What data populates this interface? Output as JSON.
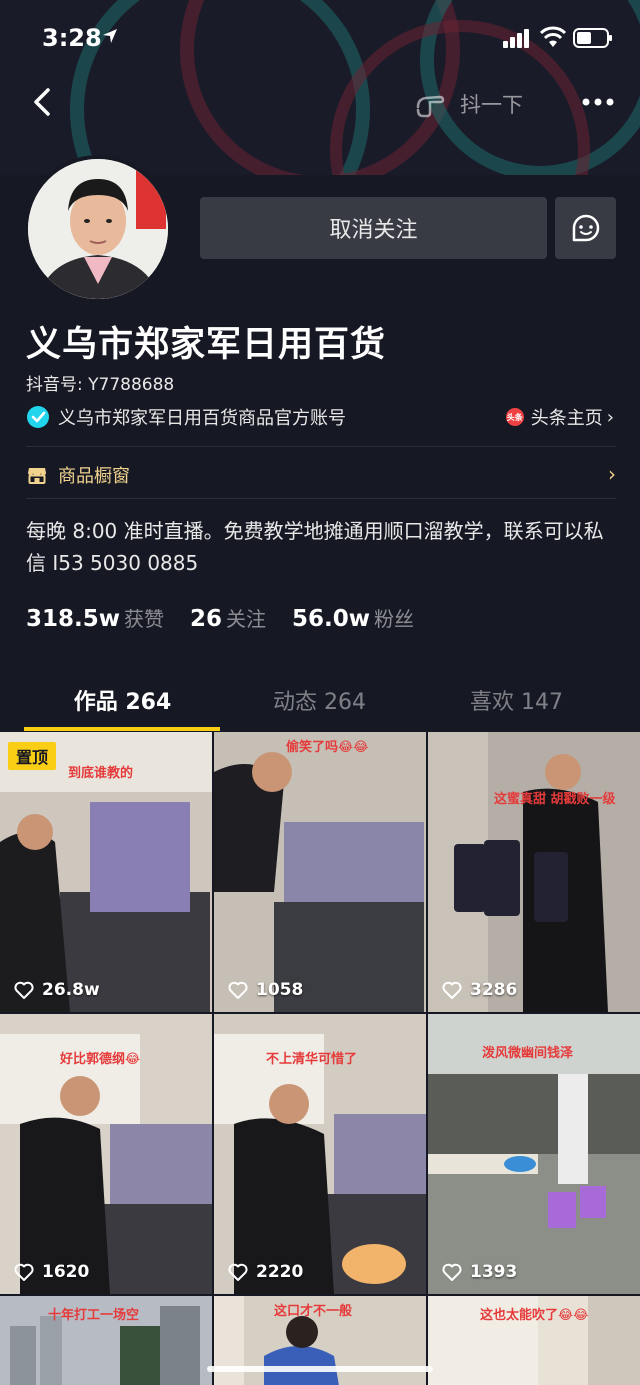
{
  "status_bar": {
    "time": "3:28"
  },
  "nav": {
    "shake_label": "抖一下"
  },
  "profile": {
    "unfollow_label": "取消关注",
    "name": "义乌市郑家军日用百货",
    "douyin_id": "抖音号: Y7788688",
    "verified_text": "义乌市郑家军日用百货商品官方账号",
    "toutiao_badge": "头条",
    "toutiao_label": "头条主页",
    "chevron": "›",
    "shop_label": "商品橱窗",
    "shop_chevron": "›",
    "bio": "每晚 8:00 准时直播。免费教学地摊通用顺口溜教学，联系可以私信 I53 5030 0885",
    "stats": [
      {
        "num": "318.5w",
        "label": "获赞"
      },
      {
        "num": "26",
        "label": "关注"
      },
      {
        "num": "56.0w",
        "label": "粉丝"
      }
    ]
  },
  "tabs": [
    {
      "label": "作品 264"
    },
    {
      "label": "动态 264"
    },
    {
      "label": "喜欢 147"
    }
  ],
  "videos": [
    {
      "pin": "置顶",
      "caption": "到底谁教的",
      "likes": "26.8w"
    },
    {
      "caption": "偷笑了吗😂😂",
      "likes": "1058"
    },
    {
      "caption": "这蜜真甜 胡戳败一级",
      "likes": "3286"
    },
    {
      "caption": "好比郭德纲😂",
      "likes": "1620"
    },
    {
      "caption": "不上清华可惜了",
      "likes": "2220"
    },
    {
      "caption": "泼风微幽间钱泽",
      "likes": "1393"
    },
    {
      "caption": "十年打工一场空",
      "likes": ""
    },
    {
      "caption": "这口才不一般",
      "likes": ""
    },
    {
      "caption": "这也太能吹了😂😂",
      "likes": ""
    }
  ],
  "colors": {
    "background": "#161823",
    "accent_yellow": "#face15",
    "shop_gold": "#f1d38e",
    "button_bg": "#393b44",
    "verified_blue": "#20d5ec",
    "toutiao_red": "#f04142"
  }
}
